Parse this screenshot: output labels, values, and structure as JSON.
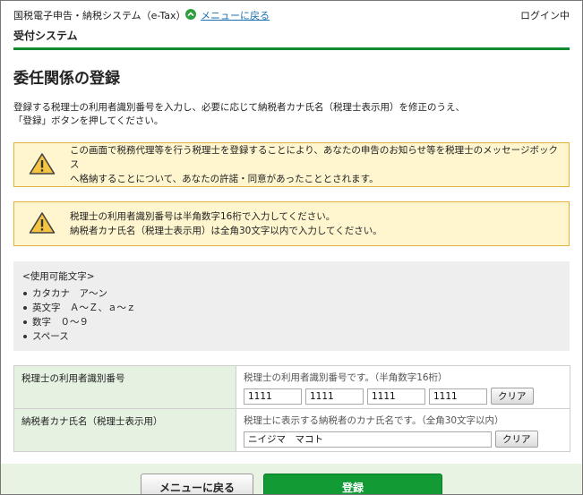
{
  "header": {
    "system_name": "国税電子申告・納税システム（e-Tax）",
    "back_link": "メニューに戻る",
    "login_status": "ログイン中",
    "subsystem": "受付システム"
  },
  "page": {
    "title": "委任関係の登録",
    "intro_line1": "登録する税理士の利用者識別番号を入力し、必要に応じて納税者カナ氏名（税理士表示用）を修正のうえ、",
    "intro_line2": "「登録」ボタンを押してください。"
  },
  "alerts": {
    "alert1_line1": "この画面で税務代理等を行う税理士を登録することにより、あなたの申告のお知らせ等を税理士のメッセージボックス",
    "alert1_line2": "へ格納することについて、あなたの許諾・同意があったこととされます。",
    "alert2_line1": "税理士の利用者識別番号は半角数字16桁で入力してください。",
    "alert2_line2": "納税者カナ氏名（税理士表示用）は全角30文字以内で入力してください。"
  },
  "charset": {
    "heading": "<使用可能文字>",
    "items": [
      "カタカナ　ア～ン",
      "英文字　Ａ～Ｚ、ａ～ｚ",
      "数字　０～９",
      "スペース"
    ]
  },
  "form": {
    "tax_id": {
      "label": "税理士の利用者識別番号",
      "hint": "税理士の利用者識別番号です。（半角数字16桁）",
      "values": [
        "1111",
        "1111",
        "1111",
        "1111"
      ],
      "clear_label": "クリア"
    },
    "kana_name": {
      "label": "納税者カナ氏名（税理士表示用）",
      "hint": "税理士に表示する納税者のカナ氏名です。（全角30文字以内）",
      "value": "ニイジマ　マコト",
      "clear_label": "クリア"
    }
  },
  "footer": {
    "back_label": "メニューに戻る",
    "register_label": "登録"
  },
  "colors": {
    "accent_green": "#0f8a2e",
    "alert_bg": "#fff6cf",
    "alert_border": "#e0b43a",
    "link_blue": "#1a6fb0"
  },
  "icons": {
    "back": "circle-chevron-up-icon",
    "warning": "warning-triangle-icon"
  }
}
